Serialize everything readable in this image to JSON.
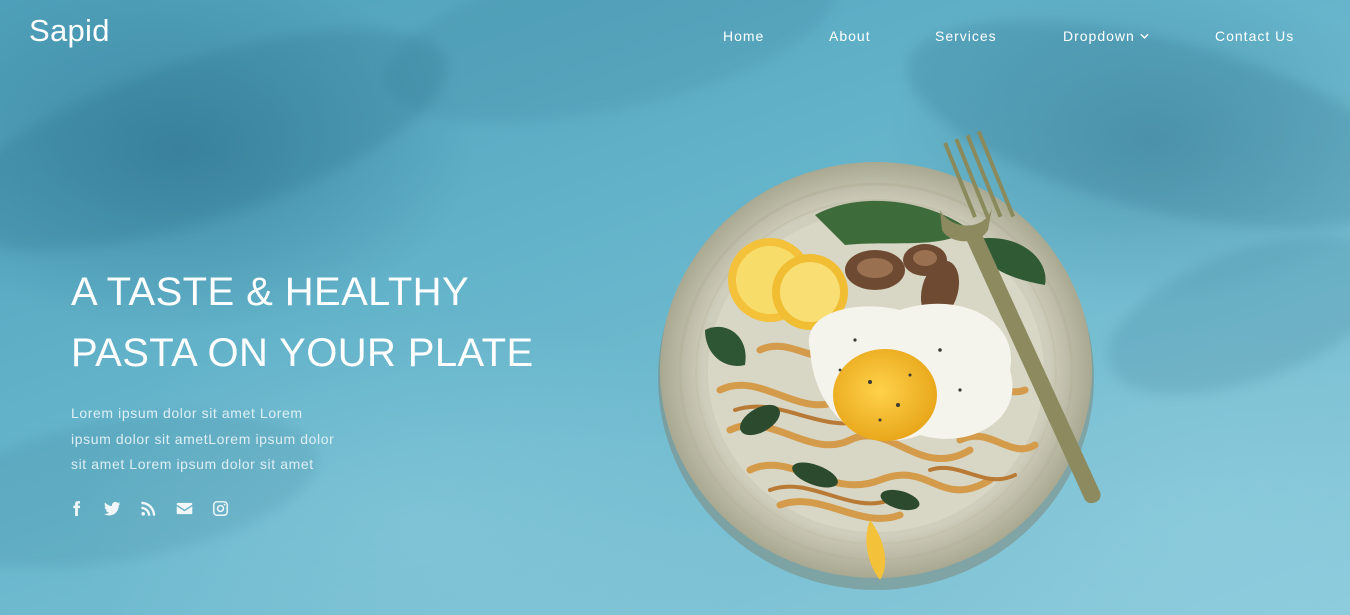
{
  "brand": {
    "name": "Sapid"
  },
  "nav": {
    "items": [
      {
        "label": "Home"
      },
      {
        "label": "About"
      },
      {
        "label": "Services"
      },
      {
        "label": "Dropdown"
      },
      {
        "label": "Contact Us"
      }
    ]
  },
  "hero": {
    "headline_line1": "A TASTE & HEALTHY",
    "headline_line2": "PASTA ON YOUR PLATE",
    "lead_line1": "Lorem ipsum dolor sit amet Lorem",
    "lead_line2": "ipsum dolor sit ametLorem ipsum dolor",
    "lead_line3": "sit amet Lorem ipsum dolor sit amet"
  },
  "social": {
    "icons": [
      "facebook-icon",
      "twitter-icon",
      "rss-icon",
      "envelope-icon",
      "instagram-icon"
    ]
  },
  "colors": {
    "background": "#5fb0c8",
    "text": "#ffffff"
  }
}
